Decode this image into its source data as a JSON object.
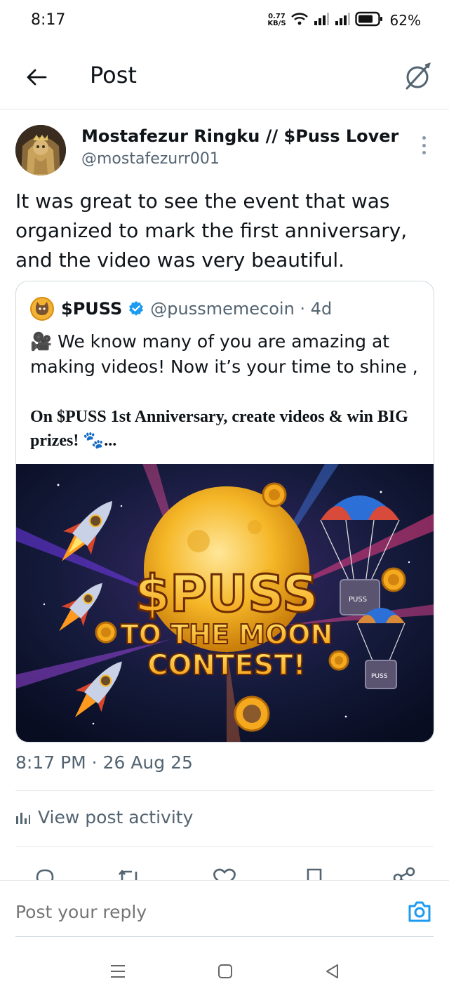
{
  "status_bar": {
    "time": "8:17",
    "net_speed_value": "0.77",
    "net_speed_unit": "KB/S",
    "battery_percent": "62%"
  },
  "header": {
    "title": "Post"
  },
  "post": {
    "author_name": "Mostafezur Ringku // $Puss Lover",
    "author_handle": "@mostafezurr001",
    "text": "It was great to see the event that was organized to mark the first anniversary, and the video was very beautiful.",
    "timestamp": "8:17 PM · 26 Aug 25",
    "activity_label": "View post activity"
  },
  "quote": {
    "name": "$PUSS",
    "handle_time": "@pussmemecoin · 4d",
    "text_line1": "🎥 We know many of you are amazing at making videos! Now it’s your time to shine ,",
    "text_line2": "On $PUSS 1st Anniversary, create videos & win BIG prizes! 🐾...",
    "image": {
      "title_line1": "$PUSS",
      "title_line2": "TO THE MOON",
      "title_line3": "CONTEST!",
      "crate_label": "PUSS"
    }
  },
  "reply": {
    "placeholder": "Post your reply"
  },
  "colors": {
    "text_primary": "#0f1419",
    "text_secondary": "#536471",
    "accent": "#1d9bf0",
    "border": "#cfd9de"
  }
}
